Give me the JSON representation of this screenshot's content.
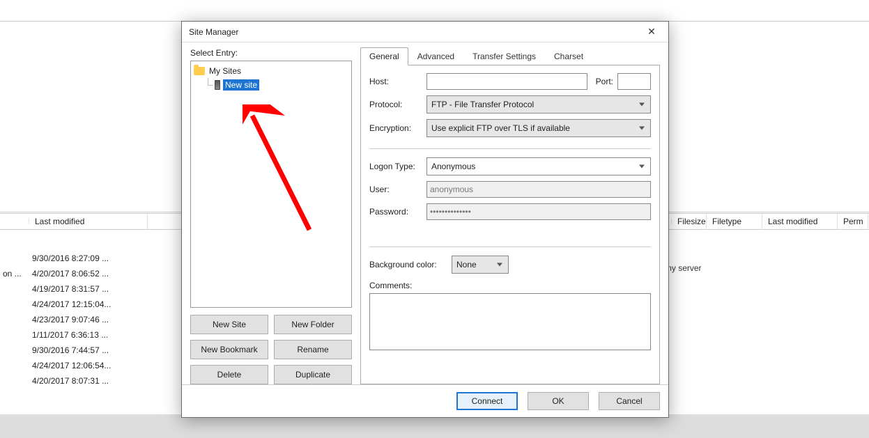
{
  "bg": {
    "headers_left": {
      "last_modified": "Last modified"
    },
    "headers_right": {
      "filesize": "Filesize",
      "filetype": "Filetype",
      "last_modified": "Last modified",
      "perm": "Perm"
    },
    "rows": [
      {
        "name": "",
        "mod": "9/30/2016 8:27:09 ..."
      },
      {
        "name": "on ...",
        "mod": "4/20/2017 8:06:52 ..."
      },
      {
        "name": "",
        "mod": "4/19/2017 8:31:57 ..."
      },
      {
        "name": "",
        "mod": "4/24/2017 12:15:04..."
      },
      {
        "name": "",
        "mod": "4/23/2017 9:07:46 ..."
      },
      {
        "name": "",
        "mod": "1/11/2017 6:36:13 ..."
      },
      {
        "name": "",
        "mod": "9/30/2016 7:44:57 ..."
      },
      {
        "name": "",
        "mod": "4/24/2017 12:06:54..."
      },
      {
        "name": "",
        "mod": "4/20/2017 8:07:31 ..."
      }
    ],
    "not_connected": "Not connected to any server"
  },
  "dialog": {
    "title": "Site Manager",
    "select_entry": "Select Entry:",
    "tree": {
      "root": "My Sites",
      "item": "New site"
    },
    "buttons": {
      "new_site": "New Site",
      "new_folder": "New Folder",
      "new_bookmark": "New Bookmark",
      "rename": "Rename",
      "delete": "Delete",
      "duplicate": "Duplicate"
    },
    "tabs": {
      "general": "General",
      "advanced": "Advanced",
      "transfer": "Transfer Settings",
      "charset": "Charset"
    },
    "form": {
      "host_label": "Host:",
      "port_label": "Port:",
      "protocol_label": "Protocol:",
      "protocol_value": "FTP - File Transfer Protocol",
      "encryption_label": "Encryption:",
      "encryption_value": "Use explicit FTP over TLS if available",
      "logon_type_label": "Logon Type:",
      "logon_type_value": "Anonymous",
      "user_label": "User:",
      "user_value": "anonymous",
      "password_label": "Password:",
      "password_value": "••••••••••••••",
      "bg_color_label": "Background color:",
      "bg_color_value": "None",
      "comments_label": "Comments:"
    },
    "footer": {
      "connect": "Connect",
      "ok": "OK",
      "cancel": "Cancel"
    }
  }
}
